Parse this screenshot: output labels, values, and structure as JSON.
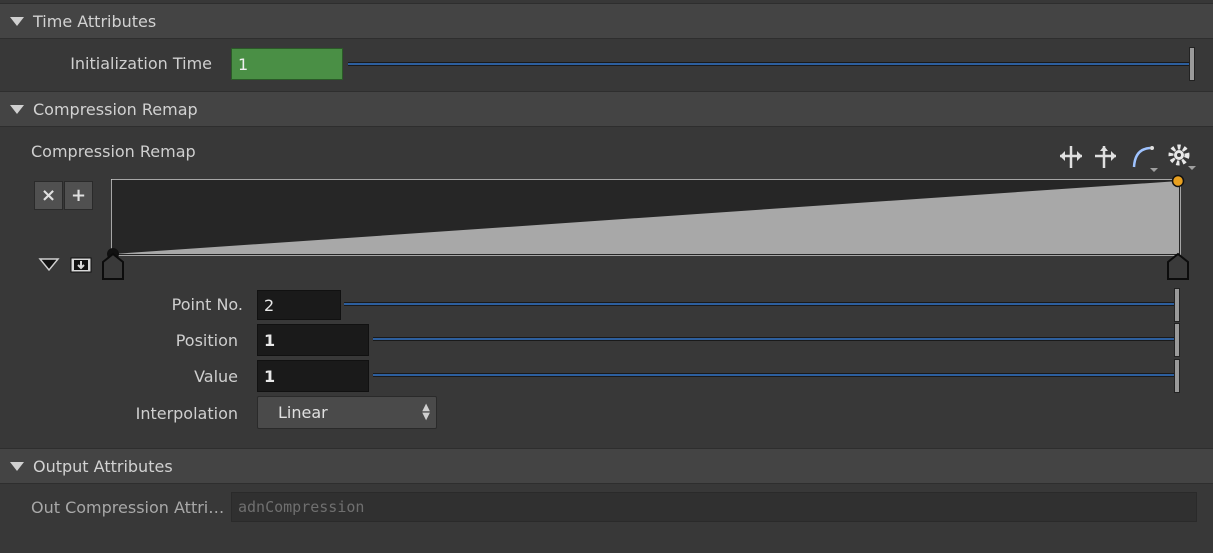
{
  "sections": {
    "time": {
      "title": "Time Attributes"
    },
    "remap": {
      "title": "Compression Remap"
    },
    "output": {
      "title": "Output Attributes"
    }
  },
  "time_attributes": {
    "init_time_label": "Initialization Time",
    "init_time_value": "1"
  },
  "compression_remap": {
    "ramp_label": "Compression Remap",
    "delete_point_glyph": "×",
    "add_point_glyph": "+",
    "point_no_label": "Point No.",
    "point_no_value": "2",
    "position_label": "Position",
    "position_value": "1",
    "value_label": "Value",
    "value_value": "1",
    "interpolation_label": "Interpolation",
    "interpolation_value": "Linear"
  },
  "output_attributes": {
    "out_attr_label": "Out Compression Attri…",
    "out_attr_value": "adnCompression"
  },
  "colors": {
    "accent_green": "#4a8f45",
    "slider_blue": "#2d5f9e",
    "ramp_fill": "#a8a8a8",
    "ramp_bg": "#262626",
    "point_selected": "#e8a020"
  },
  "icons": [
    "collapse-triangle-icon",
    "delete-point-icon",
    "add-point-icon",
    "expand-triangle-icon",
    "save-preset-icon",
    "move-horizontal-icon",
    "move-vertical-icon",
    "curve-type-icon",
    "gear-icon"
  ]
}
